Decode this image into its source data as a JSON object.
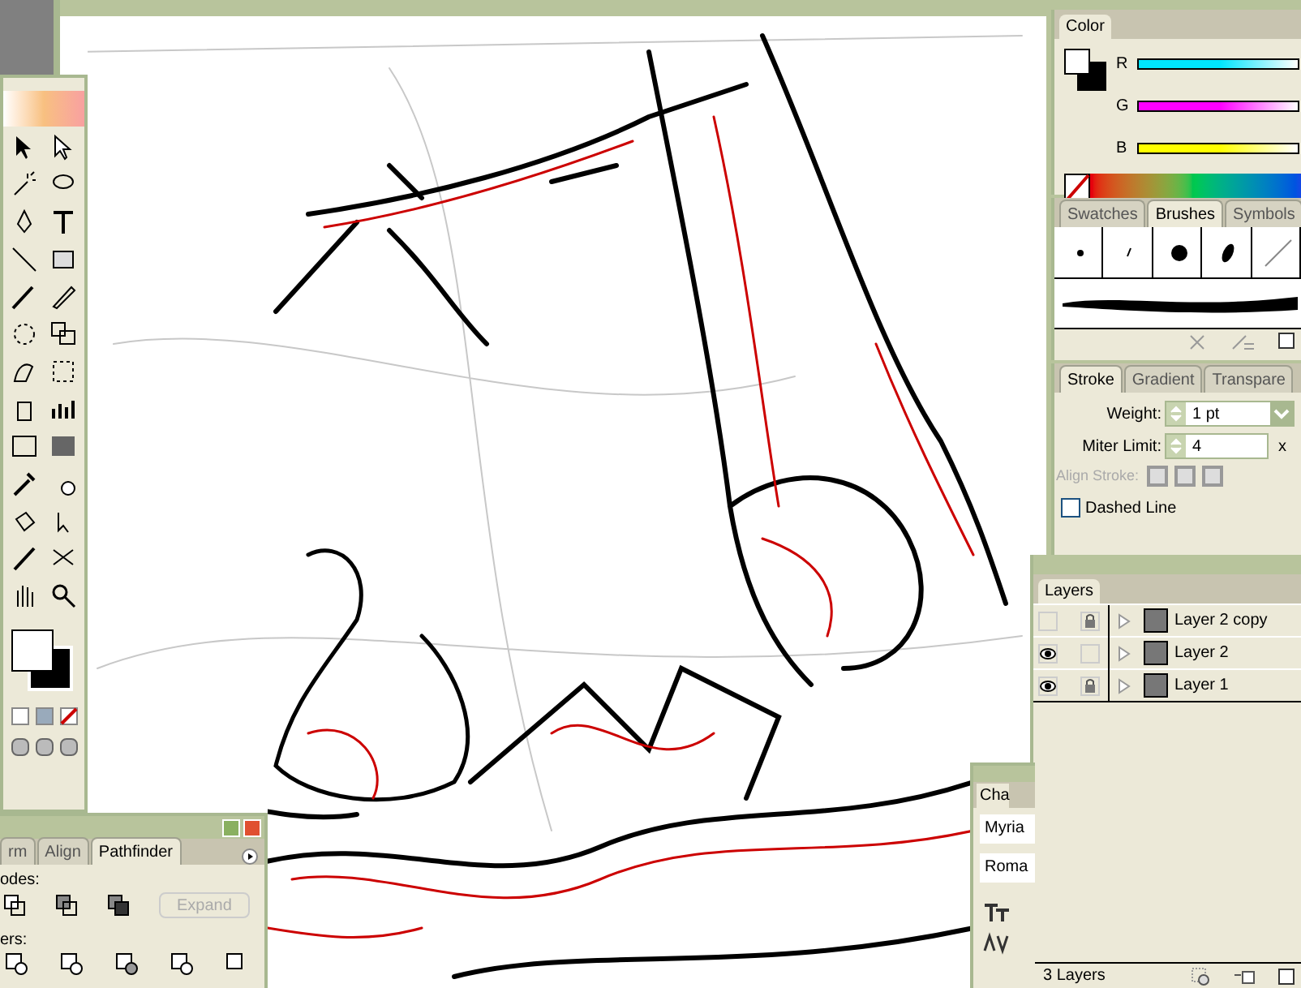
{
  "color_panel": {
    "tab": "Color",
    "channels": [
      {
        "label": "R",
        "color": "#00e5ff"
      },
      {
        "label": "G",
        "color": "#ff00ff"
      },
      {
        "label": "B",
        "color": "#ffff00"
      }
    ]
  },
  "brushes_panel": {
    "tabs": [
      {
        "label": "Swatches",
        "selected": false
      },
      {
        "label": "Brushes",
        "selected": true
      },
      {
        "label": "Symbols",
        "selected": false
      }
    ]
  },
  "stroke_panel": {
    "tabs": [
      {
        "label": "Stroke",
        "selected": true
      },
      {
        "label": "Gradient",
        "selected": false
      },
      {
        "label": "Transpare",
        "selected": false
      }
    ],
    "weight_label": "Weight:",
    "weight": "1 pt",
    "miter_label": "Miter Limit:",
    "miter": "4",
    "miter_unit": "x",
    "align_label": "Align Stroke:",
    "align_disabled": true,
    "dashed_label": "Dashed Line",
    "dashed_checked": false
  },
  "layers_panel": {
    "tab": "Layers",
    "layers": [
      {
        "name": "Layer 2 copy",
        "visible": false,
        "locked": true
      },
      {
        "name": "Layer 2",
        "visible": true,
        "locked": false
      },
      {
        "name": "Layer 1",
        "visible": true,
        "locked": true
      }
    ],
    "status": "3 Layers"
  },
  "pathfinder_panel": {
    "tabs": [
      {
        "label": "rm",
        "selected": false
      },
      {
        "label": "Align",
        "selected": false
      },
      {
        "label": "Pathfinder",
        "selected": true
      }
    ],
    "modes_label": "odes:",
    "expand": "Expand",
    "expand_disabled": true,
    "pathfinders_label": "ers:"
  },
  "character_panel": {
    "tab": "Cha",
    "font": "Myria",
    "style": "Roma"
  }
}
